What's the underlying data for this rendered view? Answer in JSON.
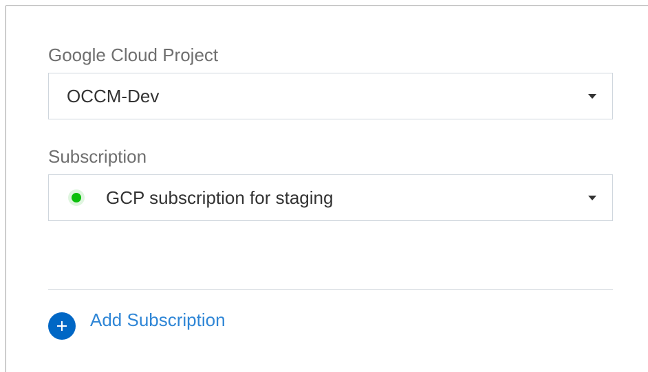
{
  "form": {
    "project": {
      "label": "Google Cloud Project",
      "value": "OCCM-Dev"
    },
    "subscription": {
      "label": "Subscription",
      "value": "GCP subscription for staging",
      "status_icon": "status-dot-icon"
    },
    "add_subscription": {
      "label": "Add Subscription",
      "icon": "plus-circle-icon"
    }
  },
  "colors": {
    "accent": "#0067c5",
    "link": "#2f86d6",
    "status_ok": "#0bbf0b",
    "status_ok_halo": "#dff5df",
    "label_text": "#6f6f6f",
    "value_text": "#333333",
    "border": "#cfd6dd"
  }
}
